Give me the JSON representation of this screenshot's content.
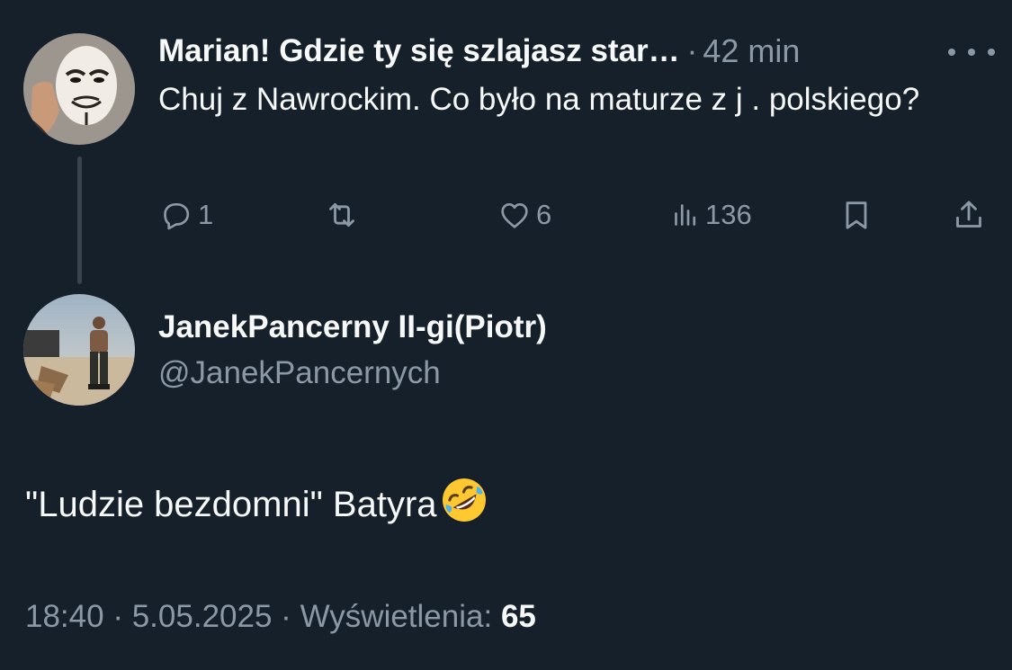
{
  "reply": {
    "author_name": "Marian! Gdzie ty się szlajasz star…",
    "separator": "·",
    "time": "42 min",
    "text": "Chuj z Nawrockim. Co było na maturze z j . polskiego?",
    "reply_count": "1",
    "like_count": "6",
    "view_count": "136",
    "avatar": "anonymous-mask-avatar"
  },
  "tweet": {
    "author_name": "JanekPancerny II-gi(Piotr)",
    "handle": "@JanekPancernych",
    "text": "\"Ludzie bezdomni\" Batyra",
    "emoji": "rolling-on-the-floor-laughing",
    "time": "18:40",
    "date": "5.05.2025",
    "views_label": "Wyświetlenia:",
    "views_count": "65",
    "dot": "·",
    "avatar": "man-with-firewood-avatar"
  },
  "colors": {
    "background": "#15202b",
    "primary_text": "#f7f9f9",
    "secondary_text": "#8b98a5",
    "thread_line": "#38444d",
    "emoji_face": "#fdc830"
  }
}
